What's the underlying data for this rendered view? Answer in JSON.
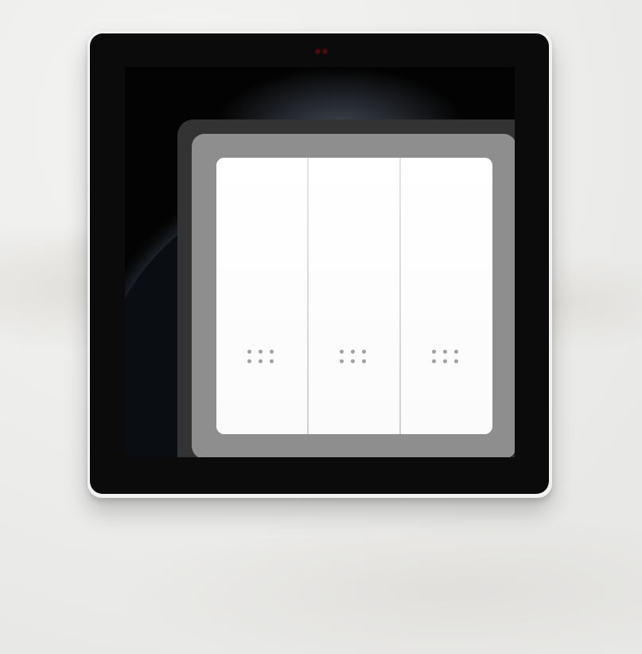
{
  "scene": {
    "wall_color": "#eeeeec",
    "panel_color": "#0b0b0b",
    "frame_color": "#8e8e8e",
    "plate_color": "#ffffff",
    "indicator_color": "#5a0a0a"
  },
  "switch": {
    "gang_count": 3,
    "rockers": [
      {
        "id": "left",
        "icon": "six-dot-grid-icon"
      },
      {
        "id": "middle",
        "icon": "six-dot-grid-icon"
      },
      {
        "id": "right",
        "icon": "six-dot-grid-icon"
      }
    ]
  }
}
